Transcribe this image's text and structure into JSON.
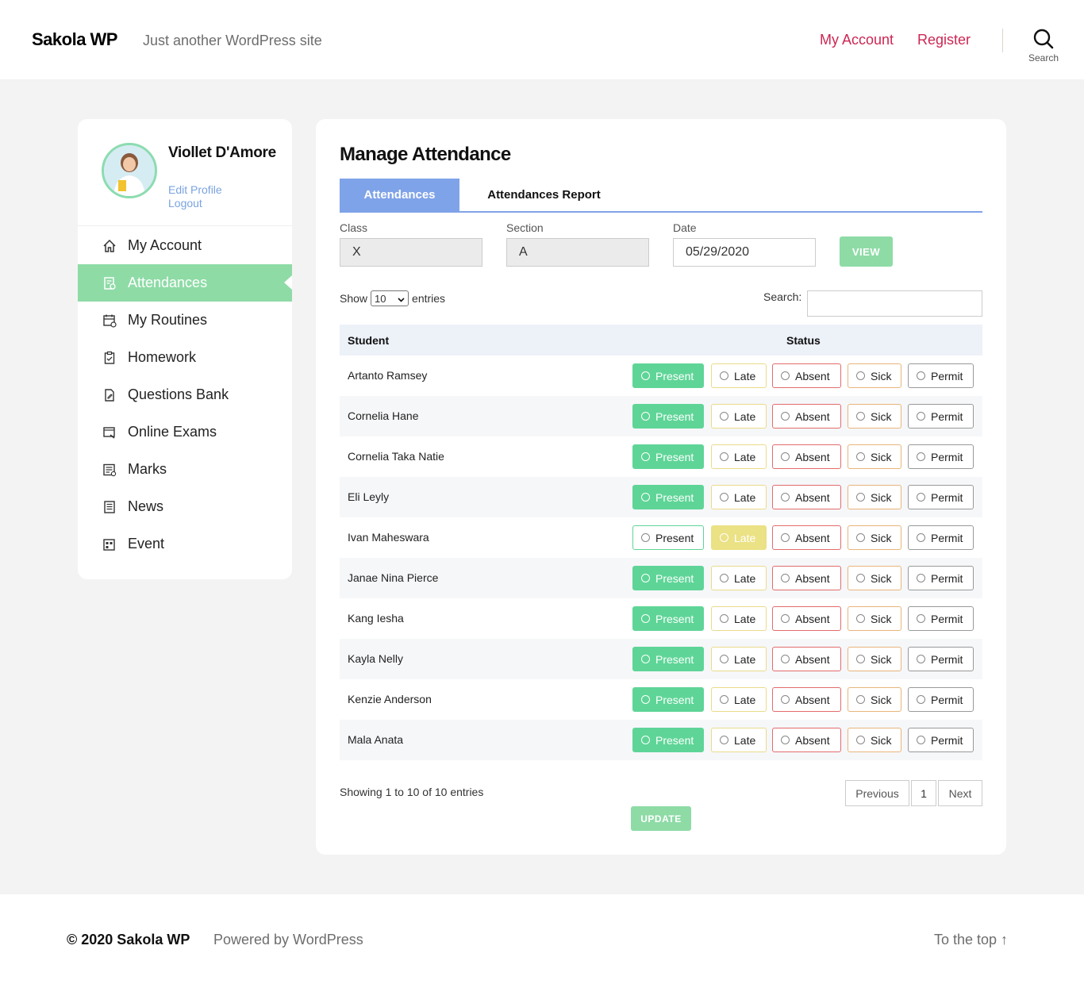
{
  "header": {
    "site_title": "Sakola WP",
    "site_description": "Just another WordPress site",
    "nav": {
      "my_account": "My Account",
      "register": "Register"
    },
    "search_label": "Search"
  },
  "sidebar": {
    "user_name": "Viollet D'Amore",
    "edit_profile": "Edit Profile",
    "logout": "Logout",
    "items": [
      {
        "label": "My Account",
        "icon": "home-icon"
      },
      {
        "label": "Attendances",
        "icon": "attendance-icon",
        "active": true
      },
      {
        "label": "My Routines",
        "icon": "calendar-icon"
      },
      {
        "label": "Homework",
        "icon": "clipboard-icon"
      },
      {
        "label": "Questions Bank",
        "icon": "document-edit-icon"
      },
      {
        "label": "Online Exams",
        "icon": "exam-icon"
      },
      {
        "label": "Marks",
        "icon": "marks-icon"
      },
      {
        "label": "News",
        "icon": "news-icon"
      },
      {
        "label": "Event",
        "icon": "event-icon"
      }
    ]
  },
  "main": {
    "title": "Manage Attendance",
    "tabs": [
      "Attendances",
      "Attendances Report"
    ],
    "filters": {
      "class_label": "Class",
      "class_value": "X",
      "section_label": "Section",
      "section_value": "A",
      "date_label": "Date",
      "date_value": "05/29/2020",
      "view_button": "VIEW"
    },
    "show_label": "Show",
    "entries_value": "10",
    "entries_label": "entries",
    "search_label": "Search:",
    "columns": [
      "Student",
      "Status"
    ],
    "status_options": [
      "Present",
      "Late",
      "Absent",
      "Sick",
      "Permit"
    ],
    "rows": [
      {
        "name": "Artanto Ramsey",
        "status": "Present"
      },
      {
        "name": "Cornelia Hane",
        "status": "Present"
      },
      {
        "name": "Cornelia Taka Natie",
        "status": "Present"
      },
      {
        "name": "Eli Leyly",
        "status": "Present"
      },
      {
        "name": "Ivan Maheswara",
        "status": "Late"
      },
      {
        "name": "Janae Nina Pierce",
        "status": "Present"
      },
      {
        "name": "Kang Iesha",
        "status": "Present"
      },
      {
        "name": "Kayla Nelly",
        "status": "Present"
      },
      {
        "name": "Kenzie Anderson",
        "status": "Present"
      },
      {
        "name": "Mala Anata",
        "status": "Present"
      }
    ],
    "showing_text": "Showing 1 to 10 of 10 entries",
    "pagination": {
      "previous": "Previous",
      "page": "1",
      "next": "Next"
    },
    "update_button": "UPDATE"
  },
  "footer": {
    "copyright": "© 2020 Sakola WP",
    "powered": "Powered by WordPress",
    "to_top": "To the top ↑"
  },
  "colors": {
    "accent_green": "#8edba6",
    "present_green": "#5ed597",
    "late_yellow": "#ebe185",
    "tab_blue": "#7fa3e8",
    "link_red": "#cd2653"
  }
}
